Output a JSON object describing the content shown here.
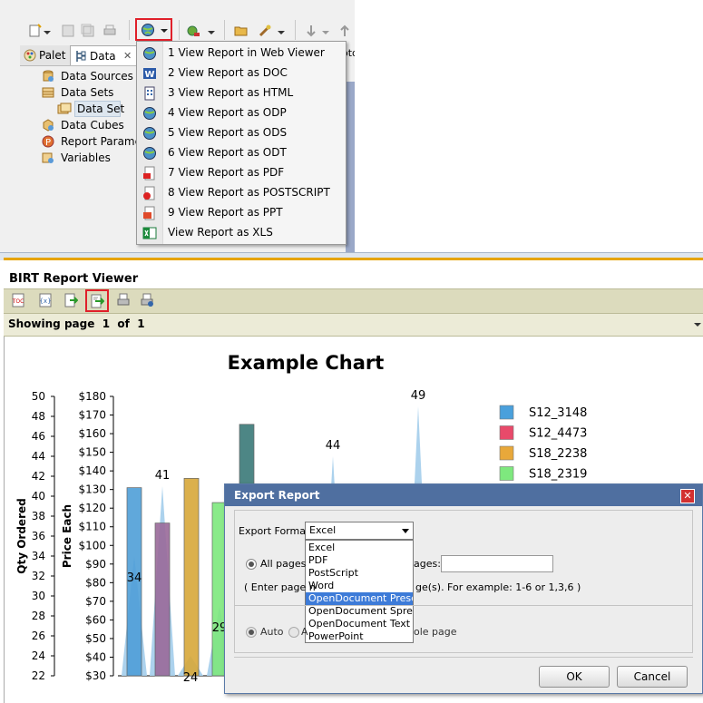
{
  "eclipse": {
    "tabs": [
      {
        "label": "Palet"
      },
      {
        "label": "Data"
      }
    ],
    "tab_close": "✕",
    "right_pane_text": "oto",
    "tree_items": [
      {
        "label": "Data Sources",
        "icon": "data-source-icon"
      },
      {
        "label": "Data Sets",
        "icon": "data-sets-icon"
      },
      {
        "label": "Data Set",
        "icon": "data-set-icon",
        "selected": true
      },
      {
        "label": "Data Cubes",
        "icon": "data-cube-icon"
      },
      {
        "label": "Report Paramete",
        "icon": "report-parameter-icon"
      },
      {
        "label": "Variables",
        "icon": "variables-icon"
      }
    ],
    "view_menu": [
      {
        "label": "1 View Report in Web Viewer",
        "icon": "globe-icon"
      },
      {
        "label": "2 View Report as DOC",
        "icon": "word-icon"
      },
      {
        "label": "3 View Report as HTML",
        "icon": "html-icon"
      },
      {
        "label": "4 View Report as ODP",
        "icon": "globe-icon"
      },
      {
        "label": "5 View Report as ODS",
        "icon": "globe-icon"
      },
      {
        "label": "6 View Report as ODT",
        "icon": "globe-icon"
      },
      {
        "label": "7 View Report as PDF",
        "icon": "pdf-icon"
      },
      {
        "label": "8 View Report as POSTSCRIPT",
        "icon": "postscript-icon"
      },
      {
        "label": "9 View Report as PPT",
        "icon": "ppt-icon"
      },
      {
        "label": "View Report as XLS",
        "icon": "excel-icon"
      }
    ]
  },
  "viewer": {
    "title": "BIRT Report Viewer",
    "page_status": "Showing page  1  of  1",
    "highlight_color": "#e0202a"
  },
  "chart_data": {
    "type": "bar",
    "title": "Example Chart",
    "y_left_label": "Qty Ordered",
    "y_left_ticks": [
      50,
      48,
      46,
      44,
      42,
      40,
      38,
      36,
      34,
      32,
      30,
      28,
      26,
      24,
      22
    ],
    "y_left_range": [
      22,
      50
    ],
    "y_right_label": "Price Each",
    "y_right_ticks": [
      "$180",
      "$170",
      "$160",
      "$150",
      "$140",
      "$130",
      "$120",
      "$110",
      "$100",
      "$90",
      "$80",
      "$70",
      "$60",
      "$50",
      "$40",
      "$30"
    ],
    "y_right_range": [
      30,
      180
    ],
    "series": [
      {
        "name": "S12_3148",
        "color": "#4aa0dc",
        "value": 131
      },
      {
        "name": "S12_4473",
        "color": "#e84a6a",
        "value": 112
      },
      {
        "name": "S18_2238",
        "color": "#e8a83a",
        "value": 136
      },
      {
        "name": "S18_2319",
        "color": "#7ee87e",
        "value": 123
      },
      {
        "name": "",
        "color": "#2e7f7a",
        "value": 165
      }
    ],
    "bar_fill": [
      "#4f9fd8",
      "#9a6a9a",
      "#d8a83a",
      "#7ee87e",
      "#3a7a78"
    ],
    "area_labels": [
      {
        "qty": 34,
        "label": "34"
      },
      {
        "qty": 41,
        "label": "41"
      },
      {
        "qty": 24,
        "label": "24"
      },
      {
        "qty": 29,
        "label": "29"
      },
      {
        "qty": 44,
        "label": "44"
      },
      {
        "qty": 49,
        "label": "49"
      }
    ],
    "legend_position": "right"
  },
  "export_dialog": {
    "title": "Export Report",
    "close": "✕",
    "format_label": "Export Format:",
    "format_value": "Excel",
    "format_options": [
      "Excel",
      "PDF",
      "PostScript",
      "Word",
      "OpenDocument Presentation",
      "OpenDocument Spreadsheet",
      "OpenDocument Text",
      "PowerPoint"
    ],
    "selected_option": "OpenDocument Presentation",
    "all_pages_label": "All pages",
    "pages_label": "ages:",
    "pages_hint": "( Enter page n",
    "pages_hint_rest": "ge(s). For example: 1-6 or 1,3,6 )",
    "auto_label": "Auto",
    "auto_rest_label": "A",
    "whole_page_label": "ole page",
    "ok_label": "OK",
    "cancel_label": "Cancel"
  }
}
